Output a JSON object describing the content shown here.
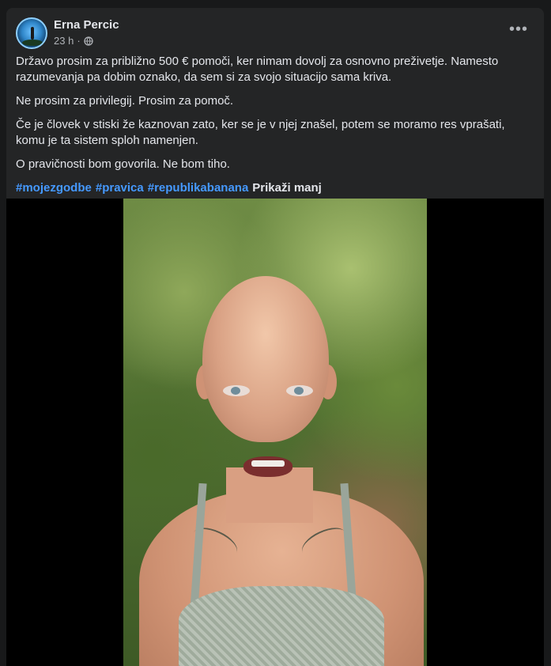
{
  "post": {
    "author": "Erna Percic",
    "time": "23 h",
    "separator": "·",
    "visibility_icon": "globe-icon",
    "more_icon": "more-options-icon",
    "paragraphs": [
      "Državo prosim za približno 500 € pomoči, ker nimam dovolj za osnovno preživetje. Namesto razumevanja pa dobim oznako, da sem si za svojo situacijo sama kriva.",
      "Ne prosim za privilegij. Prosim za pomoč.",
      "Če je človek v stiski že kaznovan zato, ker se je v njej znašel, potem se moramo res vprašati, komu je ta sistem sploh namenjen.",
      "O pravičnosti bom govorila. Ne bom tiho."
    ],
    "hashtags": [
      "#mojezgodbe",
      "#pravica",
      "#republikabanana"
    ],
    "show_less": "Prikaži manj"
  },
  "colors": {
    "background": "#18191a",
    "card": "#242526",
    "text": "#e4e6eb",
    "secondary_text": "#b0b3b8",
    "link": "#4599ff"
  }
}
